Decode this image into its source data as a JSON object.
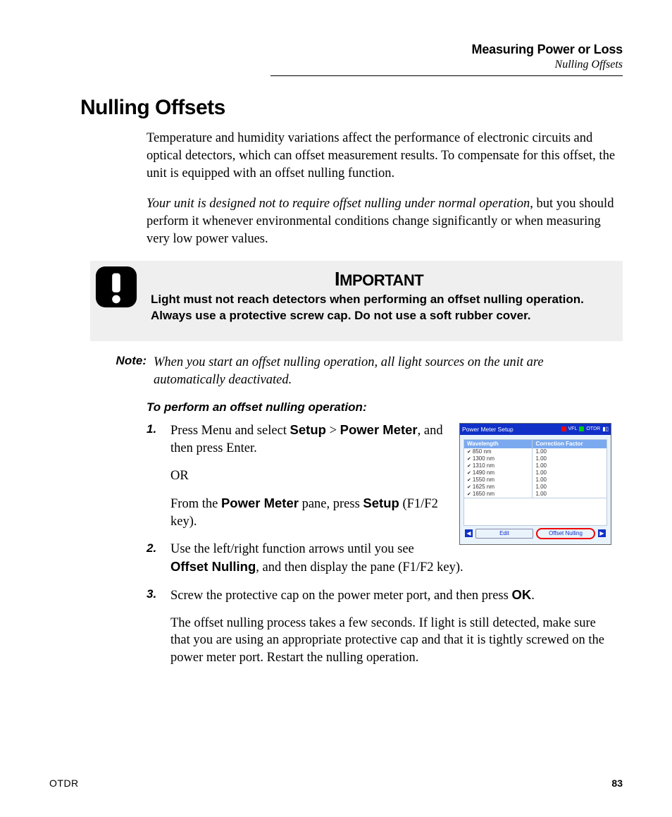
{
  "header": {
    "chapter": "Measuring Power or Loss",
    "section": "Nulling Offsets"
  },
  "h1": "Nulling Offsets",
  "para1": "Temperature and humidity variations affect the performance of electronic circuits and optical detectors, which can offset measurement results. To compensate for this offset, the unit is equipped with an offset nulling function.",
  "para2a": "Your unit is designed not to require offset nulling under normal operation",
  "para2b": ", but you should perform it whenever environmental conditions change significantly or when measuring very low power values.",
  "important": {
    "title_big": "I",
    "title_rest": "MPORTANT",
    "text": "Light must not reach detectors when performing an offset nulling operation. Always use a protective screw cap. Do not use a soft rubber cover."
  },
  "note": {
    "label": "Note:",
    "text": "When you start an offset nulling operation, all light sources on the unit are automatically deactivated."
  },
  "proc_title": "To perform an offset nulling operation:",
  "steps": {
    "s1a": "Press Menu and select ",
    "s1b": "Setup",
    "s1c": " > ",
    "s1d": "Power Meter",
    "s1e": ", and then press Enter.",
    "s1_or": "OR",
    "s1f": "From the ",
    "s1g": "Power Meter",
    "s1h": " pane, press ",
    "s1i": "Setup",
    "s1j": " (F1/F2 key).",
    "s2a": "Use the left/right function arrows until you see ",
    "s2b": "Offset Nulling",
    "s2c": ", and then display the pane (F1/F2 key).",
    "s3a": "Screw the protective cap on the power meter port, and then press ",
    "s3b": "OK",
    "s3c": ".",
    "s3d": "The offset nulling process takes a few seconds. If light is still detected, make sure that you are using an appropriate protective cap and that it is tightly screwed on the power meter port. Restart the nulling operation."
  },
  "figure": {
    "title": "Power Meter Setup",
    "badges": {
      "vfl": "VFL",
      "otdr": "OTDR"
    },
    "col1": "Wavelength",
    "col2": "Correction Factor",
    "rows": [
      {
        "w": "850 nm",
        "c": "1.00"
      },
      {
        "w": "1300 nm",
        "c": "1.00"
      },
      {
        "w": "1310 nm",
        "c": "1.00"
      },
      {
        "w": "1490 nm",
        "c": "1.00"
      },
      {
        "w": "1550 nm",
        "c": "1.00"
      },
      {
        "w": "1625 nm",
        "c": "1.00"
      },
      {
        "w": "1650 nm",
        "c": "1.00"
      }
    ],
    "btn_edit": "Edit",
    "btn_null": "Offset Nulling"
  },
  "footer": {
    "left": "OTDR",
    "page": "83"
  }
}
